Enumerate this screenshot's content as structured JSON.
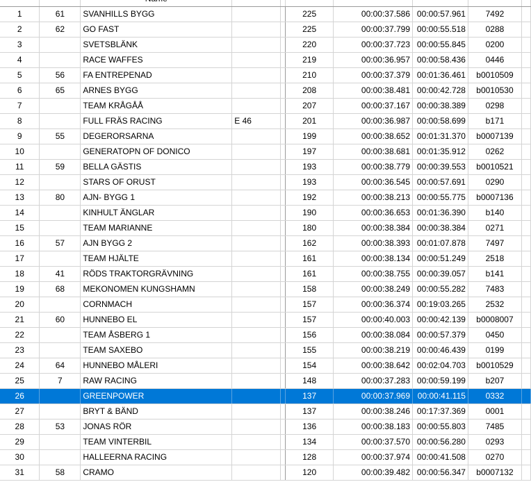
{
  "header": {
    "name_label": "Name"
  },
  "selected_index": 25,
  "rows": [
    {
      "pos": "1",
      "num": "61",
      "name": "SVANHILLS BYGG",
      "cls": "",
      "laps": "225",
      "best": "00:00:37.586",
      "last": "00:00:57.961",
      "id": "7492"
    },
    {
      "pos": "2",
      "num": "62",
      "name": "GO FAST",
      "cls": "",
      "laps": "225",
      "best": "00:00:37.799",
      "last": "00:00:55.518",
      "id": "0288"
    },
    {
      "pos": "3",
      "num": "",
      "name": "SVETSBLÄNK",
      "cls": "",
      "laps": "220",
      "best": "00:00:37.723",
      "last": "00:00:55.845",
      "id": "0200"
    },
    {
      "pos": "4",
      "num": "",
      "name": "RACE WAFFES",
      "cls": "",
      "laps": "219",
      "best": "00:00:36.957",
      "last": "00:00:58.436",
      "id": "0446"
    },
    {
      "pos": "5",
      "num": "56",
      "name": "FA ENTREPENAD",
      "cls": "",
      "laps": "210",
      "best": "00:00:37.379",
      "last": "00:01:36.461",
      "id": "b0010509"
    },
    {
      "pos": "6",
      "num": "65",
      "name": "ARNES BYGG",
      "cls": "",
      "laps": "208",
      "best": "00:00:38.481",
      "last": "00:00:42.728",
      "id": "b0010530"
    },
    {
      "pos": "7",
      "num": "",
      "name": "TEAM KRÅGÅÅ",
      "cls": "",
      "laps": "207",
      "best": "00:00:37.167",
      "last": "00:00:38.389",
      "id": "0298"
    },
    {
      "pos": "8",
      "num": "",
      "name": "FULL FRÄS RACING",
      "cls": "E 46",
      "laps": "201",
      "best": "00:00:36.987",
      "last": "00:00:58.699",
      "id": "b171"
    },
    {
      "pos": "9",
      "num": "55",
      "name": "DEGERORSARNA",
      "cls": "",
      "laps": "199",
      "best": "00:00:38.652",
      "last": "00:01:31.370",
      "id": "b0007139"
    },
    {
      "pos": "10",
      "num": "",
      "name": "GENERATOPN OF DONICO",
      "cls": "",
      "laps": "197",
      "best": "00:00:38.681",
      "last": "00:01:35.912",
      "id": "0262"
    },
    {
      "pos": "11",
      "num": "59",
      "name": "BELLA GÄSTIS",
      "cls": "",
      "laps": "193",
      "best": "00:00:38.779",
      "last": "00:00:39.553",
      "id": "b0010521"
    },
    {
      "pos": "12",
      "num": "",
      "name": "STARS OF ORUST",
      "cls": "",
      "laps": "193",
      "best": "00:00:36.545",
      "last": "00:00:57.691",
      "id": "0290"
    },
    {
      "pos": "13",
      "num": "80",
      "name": "AJN- BYGG 1",
      "cls": "",
      "laps": "192",
      "best": "00:00:38.213",
      "last": "00:00:55.775",
      "id": "b0007136"
    },
    {
      "pos": "14",
      "num": "",
      "name": "KINHULT ÄNGLAR",
      "cls": "",
      "laps": "190",
      "best": "00:00:36.653",
      "last": "00:01:36.390",
      "id": "b140"
    },
    {
      "pos": "15",
      "num": "",
      "name": "TEAM MARIANNE",
      "cls": "",
      "laps": "180",
      "best": "00:00:38.384",
      "last": "00:00:38.384",
      "id": "0271"
    },
    {
      "pos": "16",
      "num": "57",
      "name": "AJN BYGG 2",
      "cls": "",
      "laps": "162",
      "best": "00:00:38.393",
      "last": "00:01:07.878",
      "id": "7497"
    },
    {
      "pos": "17",
      "num": "",
      "name": "TEAM HJÄLTE",
      "cls": "",
      "laps": "161",
      "best": "00:00:38.134",
      "last": "00:00:51.249",
      "id": "2518"
    },
    {
      "pos": "18",
      "num": "41",
      "name": "RÖDS TRAKTORGRÄVNING",
      "cls": "",
      "laps": "161",
      "best": "00:00:38.755",
      "last": "00:00:39.057",
      "id": "b141"
    },
    {
      "pos": "19",
      "num": "68",
      "name": "MEKONOMEN KUNGSHAMN",
      "cls": "",
      "laps": "158",
      "best": "00:00:38.249",
      "last": "00:00:55.282",
      "id": "7483"
    },
    {
      "pos": "20",
      "num": "",
      "name": "CORNMACH",
      "cls": "",
      "laps": "157",
      "best": "00:00:36.374",
      "last": "00:19:03.265",
      "id": "2532"
    },
    {
      "pos": "21",
      "num": "60",
      "name": "HUNNEBO EL",
      "cls": "",
      "laps": "157",
      "best": "00:00:40.003",
      "last": "00:00:42.139",
      "id": "b0008007"
    },
    {
      "pos": "22",
      "num": "",
      "name": "TEAM ÅSBERG 1",
      "cls": "",
      "laps": "156",
      "best": "00:00:38.084",
      "last": "00:00:57.379",
      "id": "0450"
    },
    {
      "pos": "23",
      "num": "",
      "name": "TEAM SAXEBO",
      "cls": "",
      "laps": "155",
      "best": "00:00:38.219",
      "last": "00:00:46.439",
      "id": "0199"
    },
    {
      "pos": "24",
      "num": "64",
      "name": "HUNNEBO MÅLERI",
      "cls": "",
      "laps": "154",
      "best": "00:00:38.642",
      "last": "00:02:04.703",
      "id": "b0010529"
    },
    {
      "pos": "25",
      "num": "7",
      "name": "RAW RACING",
      "cls": "",
      "laps": "148",
      "best": "00:00:37.283",
      "last": "00:00:59.199",
      "id": "b207"
    },
    {
      "pos": "26",
      "num": "",
      "name": "GREENPOWER",
      "cls": "",
      "laps": "137",
      "best": "00:00:37.969",
      "last": "00:00:41.115",
      "id": "0332"
    },
    {
      "pos": "27",
      "num": "",
      "name": "BRYT & BÄND",
      "cls": "",
      "laps": "137",
      "best": "00:00:38.246",
      "last": "00:17:37.369",
      "id": "0001"
    },
    {
      "pos": "28",
      "num": "53",
      "name": "JONAS RÖR",
      "cls": "",
      "laps": "136",
      "best": "00:00:38.183",
      "last": "00:00:55.803",
      "id": "7485"
    },
    {
      "pos": "29",
      "num": "",
      "name": "TEAM VINTERBIL",
      "cls": "",
      "laps": "134",
      "best": "00:00:37.570",
      "last": "00:00:56.280",
      "id": "0293"
    },
    {
      "pos": "30",
      "num": "",
      "name": "HALLEERNA RACING",
      "cls": "",
      "laps": "128",
      "best": "00:00:37.974",
      "last": "00:00:41.508",
      "id": "0270"
    },
    {
      "pos": "31",
      "num": "58",
      "name": "CRAMO",
      "cls": "",
      "laps": "120",
      "best": "00:00:39.482",
      "last": "00:00:56.347",
      "id": "b0007132"
    }
  ]
}
